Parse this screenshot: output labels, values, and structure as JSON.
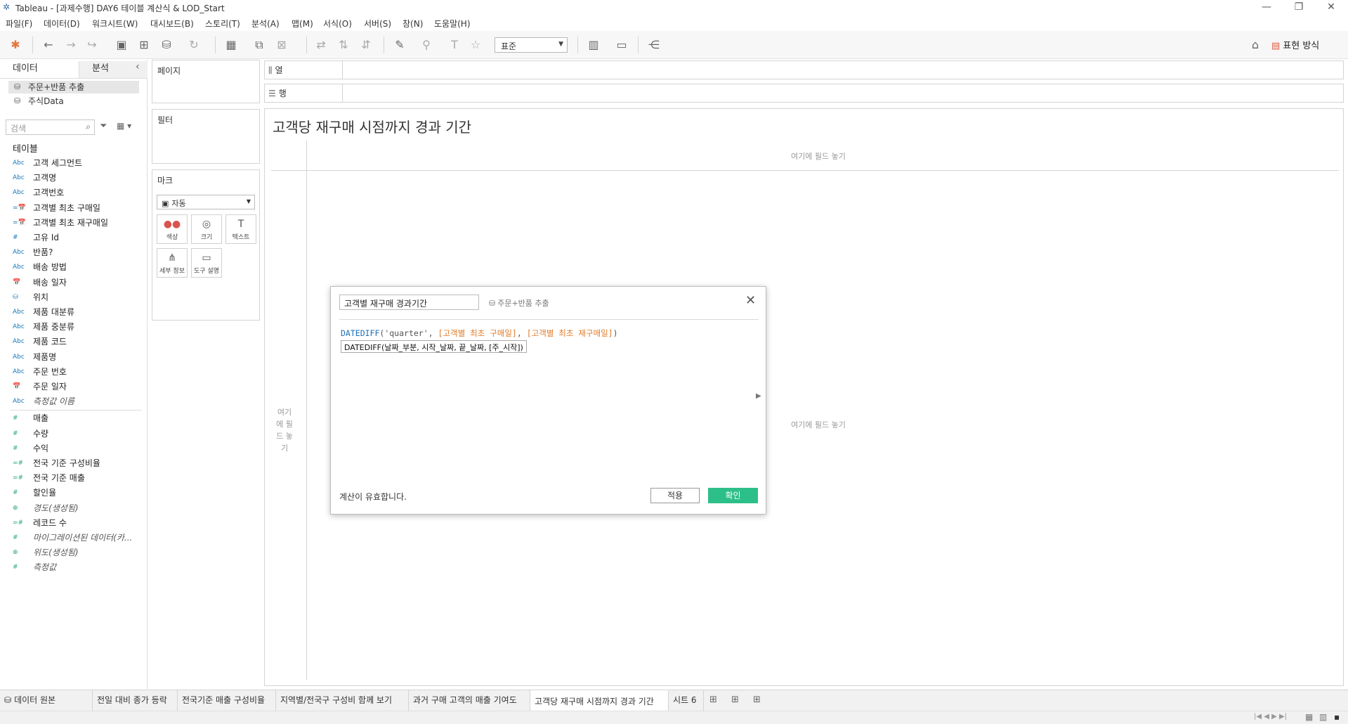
{
  "window": {
    "title": "Tableau - [과제수행] DAY6 테이블 계산식 & LOD_Start"
  },
  "menu": [
    "파일(F)",
    "데이터(D)",
    "워크시트(W)",
    "대시보드(B)",
    "스토리(T)",
    "분석(A)",
    "맵(M)",
    "서식(O)",
    "서버(S)",
    "창(N)",
    "도움말(H)"
  ],
  "toolbar": {
    "fit_value": "표준",
    "show_me": "표현 방식"
  },
  "left_pane": {
    "tab_data": "데이터",
    "tab_analysis": "분석",
    "datasources": [
      "주문+반품 추출",
      "주식Data"
    ],
    "search_placeholder": "검색",
    "tables_header": "테이블",
    "dimensions": [
      {
        "icon": "Abc",
        "label": "고객 세그먼트"
      },
      {
        "icon": "Abc",
        "label": "고객명"
      },
      {
        "icon": "Abc",
        "label": "고객번호"
      },
      {
        "icon": "=📅",
        "label": "고객별 최초 구매일"
      },
      {
        "icon": "=📅",
        "label": "고객별 최초 재구매일"
      },
      {
        "icon": "#",
        "label": "고유 Id"
      },
      {
        "icon": "Abc",
        "label": "반품?"
      },
      {
        "icon": "Abc",
        "label": "배송 방법"
      },
      {
        "icon": "📅",
        "label": "배송 일자"
      },
      {
        "icon": "⛁",
        "label": "위치"
      },
      {
        "icon": "Abc",
        "label": "제품 대분류"
      },
      {
        "icon": "Abc",
        "label": "제품 중분류"
      },
      {
        "icon": "Abc",
        "label": "제품 코드"
      },
      {
        "icon": "Abc",
        "label": "제품명"
      },
      {
        "icon": "Abc",
        "label": "주문 번호"
      },
      {
        "icon": "📅",
        "label": "주문 일자"
      },
      {
        "icon": "Abc",
        "label": "측정값 이름",
        "italic": true
      }
    ],
    "measures": [
      {
        "icon": "#",
        "label": "매출"
      },
      {
        "icon": "#",
        "label": "수량"
      },
      {
        "icon": "#",
        "label": "수익"
      },
      {
        "icon": "=#",
        "label": "전국 기준 구성비율"
      },
      {
        "icon": "=#",
        "label": "전국 기준 매출"
      },
      {
        "icon": "#",
        "label": "할인율"
      },
      {
        "icon": "⊕",
        "label": "경도(생성됨)",
        "italic": true
      },
      {
        "icon": "=#",
        "label": "레코드 수"
      },
      {
        "icon": "#",
        "label": "마이그레이션된 데이터(카...",
        "italic": true
      },
      {
        "icon": "⊕",
        "label": "위도(생성됨)",
        "italic": true
      },
      {
        "icon": "#",
        "label": "측정값",
        "italic": true
      }
    ]
  },
  "cards": {
    "pages": "페이지",
    "filters": "필터",
    "marks": "마크",
    "marks_type": "자동",
    "mark_buttons": [
      "색상",
      "크기",
      "텍스트",
      "세부 정보",
      "도구 설명"
    ]
  },
  "shelves": {
    "columns": "열",
    "rows": "행"
  },
  "view": {
    "title": "고객당 재구매 시점까지 경과 기간",
    "drop_top": "여기에 필드 놓기",
    "drop_left": "여기에 필드 놓기",
    "drop_center": "여기에 필드 놓기"
  },
  "calc_dialog": {
    "name": "고객별 재구매 경과기간",
    "datasource": "주문+반품 추출",
    "formula_fn": "DATEDIFF",
    "formula_arg1": "'quarter'",
    "formula_ref1": "[고객별 최초 구매일]",
    "formula_ref2": "[고객별 최초 재구매일]",
    "tooltip": "DATEDIFF(날짜_부분, 시작_날짜, 끝_날짜, [주_시작])",
    "status": "계산이 유효합니다.",
    "apply": "적용",
    "ok": "확인"
  },
  "sheet_tabs": [
    "데이터 원본",
    "전일 대비 종가 등락",
    "전국기준 매출 구성비율",
    "지역별/전국구 구성비 함께 보기",
    "과거 구매 고객의 매출 기여도",
    "고객당 재구매 시점까지 경과 기간",
    "시트 6"
  ],
  "active_sheet": "고객당 재구매 시점까지 경과 기간"
}
